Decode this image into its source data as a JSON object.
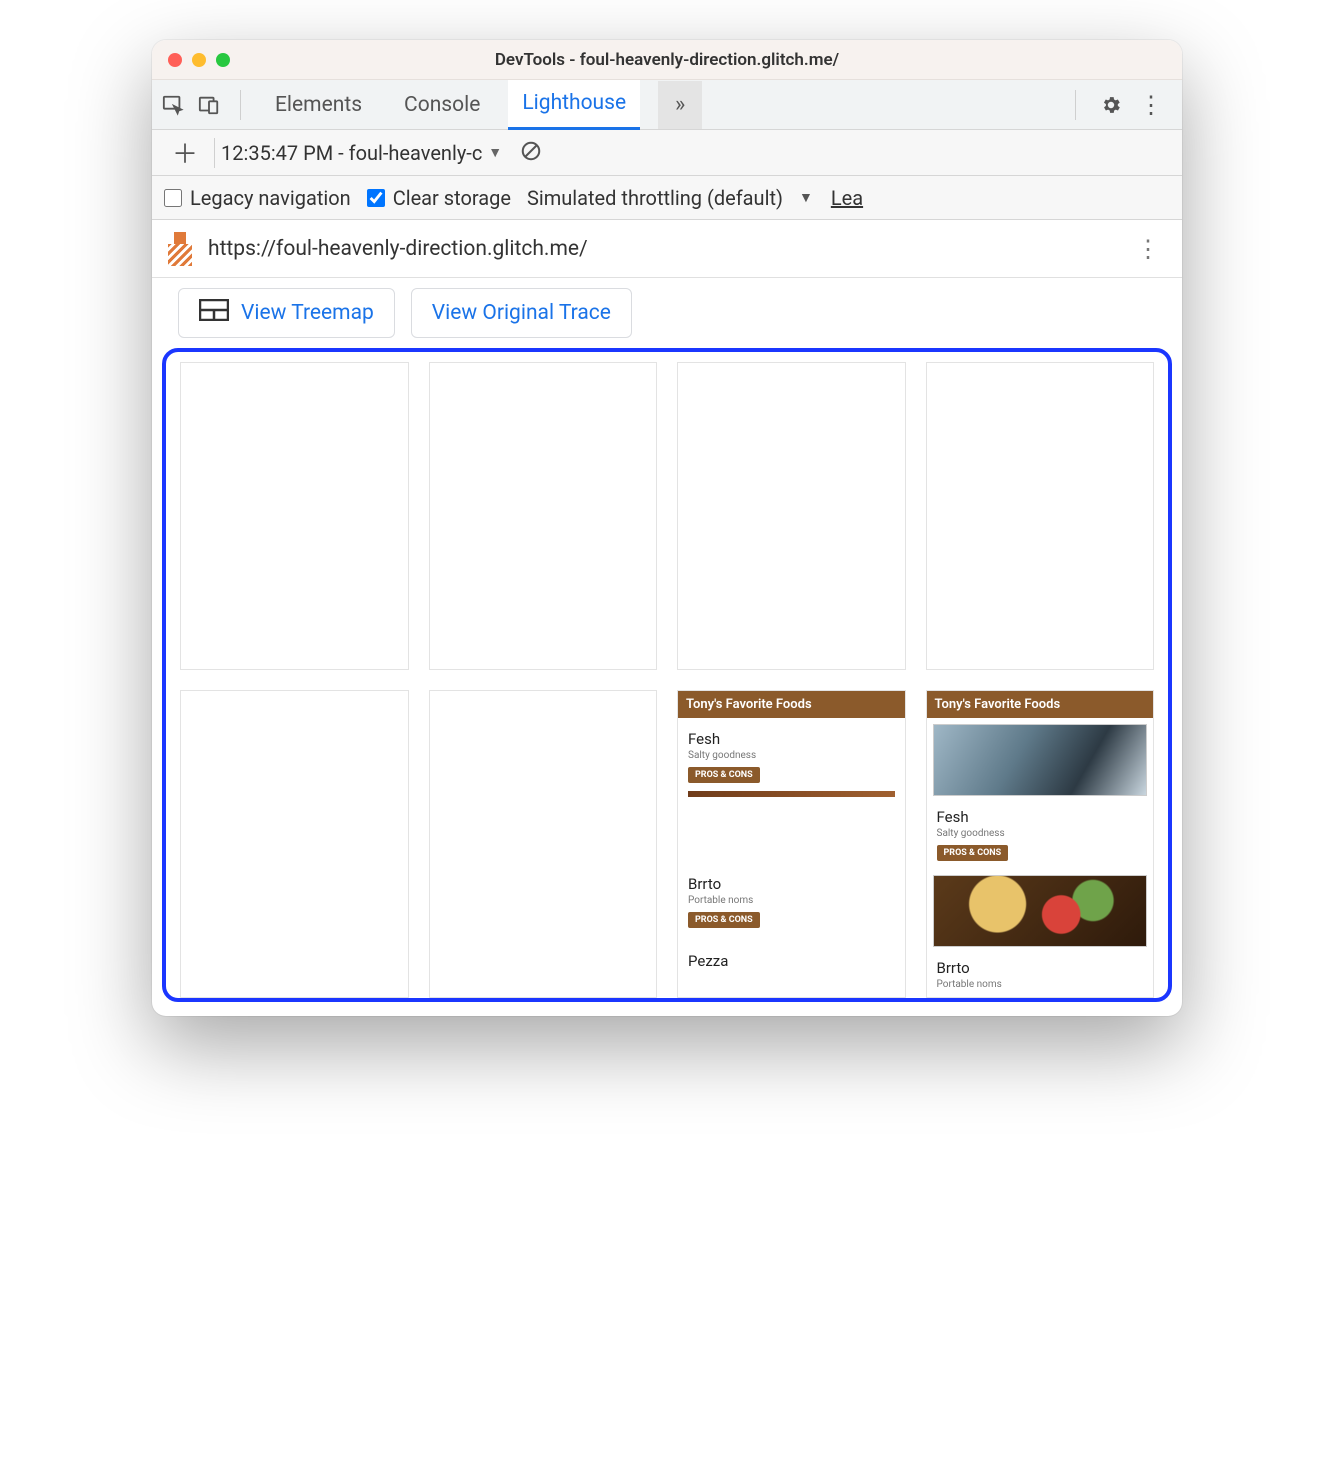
{
  "window": {
    "title": "DevTools - foul-heavenly-direction.glitch.me/"
  },
  "tabs": {
    "elements": "Elements",
    "console": "Console",
    "lighthouse": "Lighthouse",
    "overflow": "»"
  },
  "subbar1": {
    "report_name": "12:35:47 PM - foul-heavenly-c"
  },
  "options": {
    "legacy_label": "Legacy navigation",
    "legacy_checked": false,
    "clear_label": "Clear storage",
    "clear_checked": true,
    "throttling": "Simulated throttling (default)",
    "learn": "Lea"
  },
  "urlbar": {
    "url": "https://foul-heavenly-direction.glitch.me/"
  },
  "buttons": {
    "treemap": "View Treemap",
    "trace": "View Original Trace"
  },
  "filmstrip": {
    "card7": {
      "header": "Tony's Favorite Foods",
      "item1_title": "Fesh",
      "item1_sub": "Salty goodness",
      "pill": "PROS & CONS",
      "item2_title": "Brrto",
      "item2_sub": "Portable noms",
      "item3_title": "Pezza"
    },
    "card8": {
      "header": "Tony's Favorite Foods",
      "item1_title": "Fesh",
      "item1_sub": "Salty goodness",
      "pill": "PROS & CONS",
      "item2_title": "Brrto",
      "item2_sub": "Portable noms"
    }
  }
}
